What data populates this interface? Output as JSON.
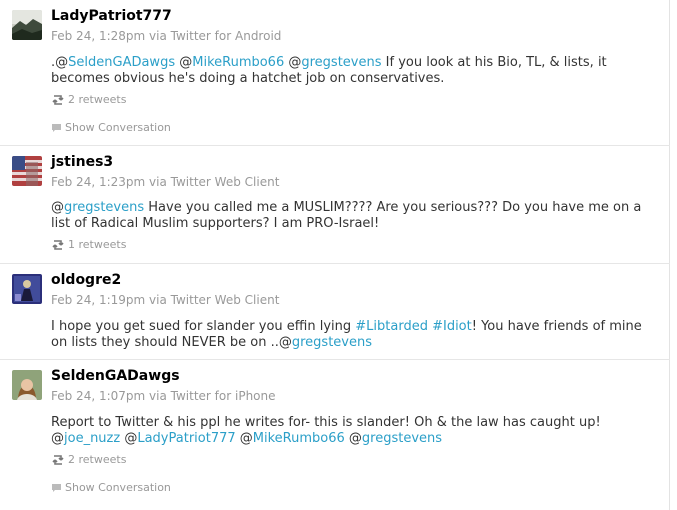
{
  "colors": {
    "link": "#2b9fc8",
    "muted": "#999999",
    "text": "#333333",
    "name": "#000000"
  },
  "tweets": [
    {
      "user": "LadyPatriot777",
      "time": "Feb 24, 1:28pm",
      "via": "via Twitter for Android",
      "avatar_icon": "mountain-landscape-avatar",
      "text": {
        "t0": ".@",
        "m1": "SeldenGADawgs",
        "t1": " @",
        "m2": "MikeRumbo66",
        "t2": " @",
        "m3": "gregstevens",
        "t3": " If you look at his Bio, TL, & lists, it becomes obvious he's doing a hatchet job on conservatives."
      },
      "retweets": "2 retweets",
      "show_conversation": "Show Conversation"
    },
    {
      "user": "jstines3",
      "time": "Feb 24, 1:23pm",
      "via": "via Twitter Web Client",
      "avatar_icon": "flag-avatar",
      "text": {
        "t0": "@",
        "m1": "gregstevens",
        "t1": " Have you called me a MUSLIM???? Are you serious??? Do you have me on a list of Radical Muslim supporters? I am PRO-Israel!"
      },
      "retweets": "1 retweets"
    },
    {
      "user": "oldogre2",
      "time": "Feb 24, 1:19pm",
      "via": "via Twitter Web Client",
      "avatar_icon": "figure-avatar",
      "text": {
        "t0": "I hope you get sued for slander you effin lying ",
        "h1": "#Libtarded",
        "t1": " ",
        "h2": "#Idiot",
        "t2": "! You have friends of mine on lists they should NEVER be on ..@",
        "m1": "gregstevens"
      }
    },
    {
      "user": "SeldenGADawgs",
      "time": "Feb 24, 1:07pm",
      "via": "via Twitter for iPhone",
      "avatar_icon": "woman-portrait-avatar",
      "text": {
        "t0": "Report to Twitter & his ppl he writes for- this is slander! Oh & the law has caught up! @",
        "m1": "joe_nuzz",
        "t1": " @",
        "m2": "LadyPatriot777",
        "t2": " @",
        "m3": "MikeRumbo66",
        "t3": " @",
        "m4": "gregstevens"
      },
      "retweets": "2 retweets",
      "show_conversation": "Show Conversation"
    }
  ]
}
